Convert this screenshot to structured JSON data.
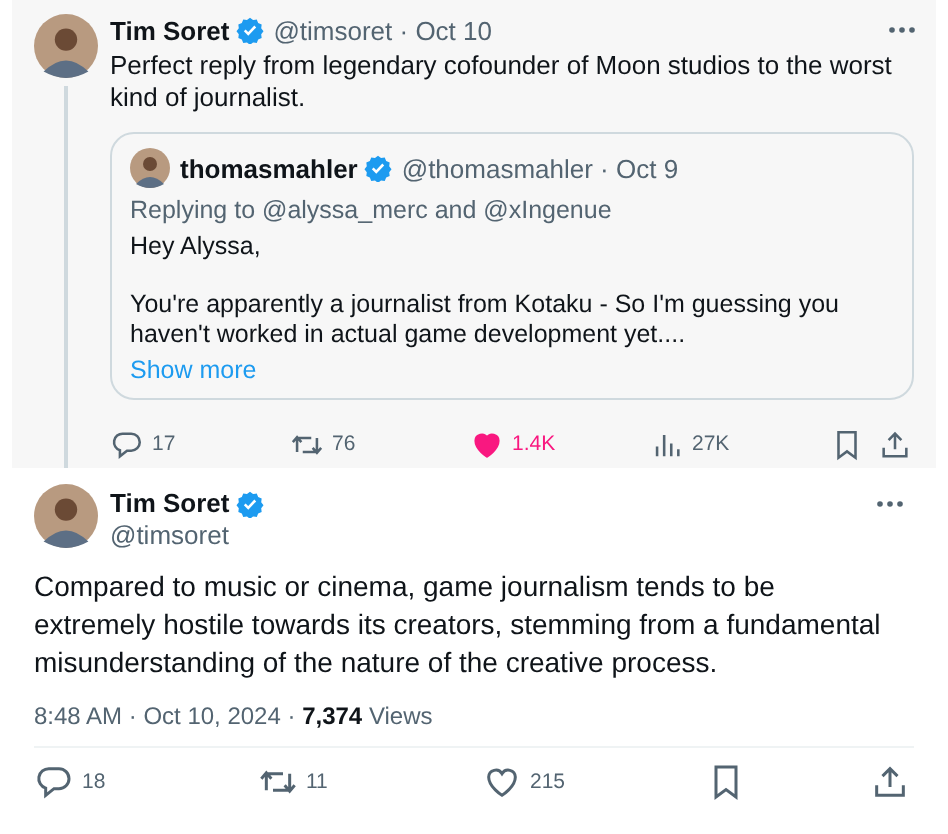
{
  "thread_tweet": {
    "author": {
      "name": "Tim Soret",
      "verified": true,
      "meta": "@timsoret · Oct 10"
    },
    "text": "Perfect reply from legendary cofounder of Moon studios to the worst kind of journalist.",
    "quote": {
      "author": {
        "name": "thomasmahler",
        "verified": true,
        "meta": "@thomasmahler · Oct 9"
      },
      "replying_to": "Replying to @alyssa_merc and @xIngenue",
      "paragraphs": [
        "Hey Alyssa,",
        "You're apparently a journalist from Kotaku - So I'm guessing you haven't worked in actual game development yet...."
      ],
      "show_more": "Show more"
    },
    "actions": [
      {
        "kind": "reply",
        "count": "17",
        "on": false
      },
      {
        "kind": "repost",
        "count": "76",
        "on": false
      },
      {
        "kind": "like",
        "count": "1.4K",
        "on": true
      },
      {
        "kind": "views",
        "count": "27K",
        "on": false
      },
      {
        "kind": "bookmark",
        "on": false
      },
      {
        "kind": "share",
        "on": false
      }
    ]
  },
  "main_tweet": {
    "author": {
      "name": "Tim Soret",
      "verified": true,
      "handle": "@timsoret"
    },
    "text": "Compared to music or cinema, game journalism tends to be extremely hostile towards its creators, stemming from a fundamental misunderstanding of the nature of the creative process.",
    "timestamp": "8:48 AM · Oct 10, 2024 · **7,374** Views",
    "actions": [
      {
        "kind": "reply",
        "count": "18",
        "on": false
      },
      {
        "kind": "repost",
        "count": "11",
        "on": false
      },
      {
        "kind": "like",
        "count": "215",
        "on": false
      },
      {
        "kind": "bookmark",
        "on": false
      },
      {
        "kind": "share",
        "on": false
      }
    ]
  }
}
